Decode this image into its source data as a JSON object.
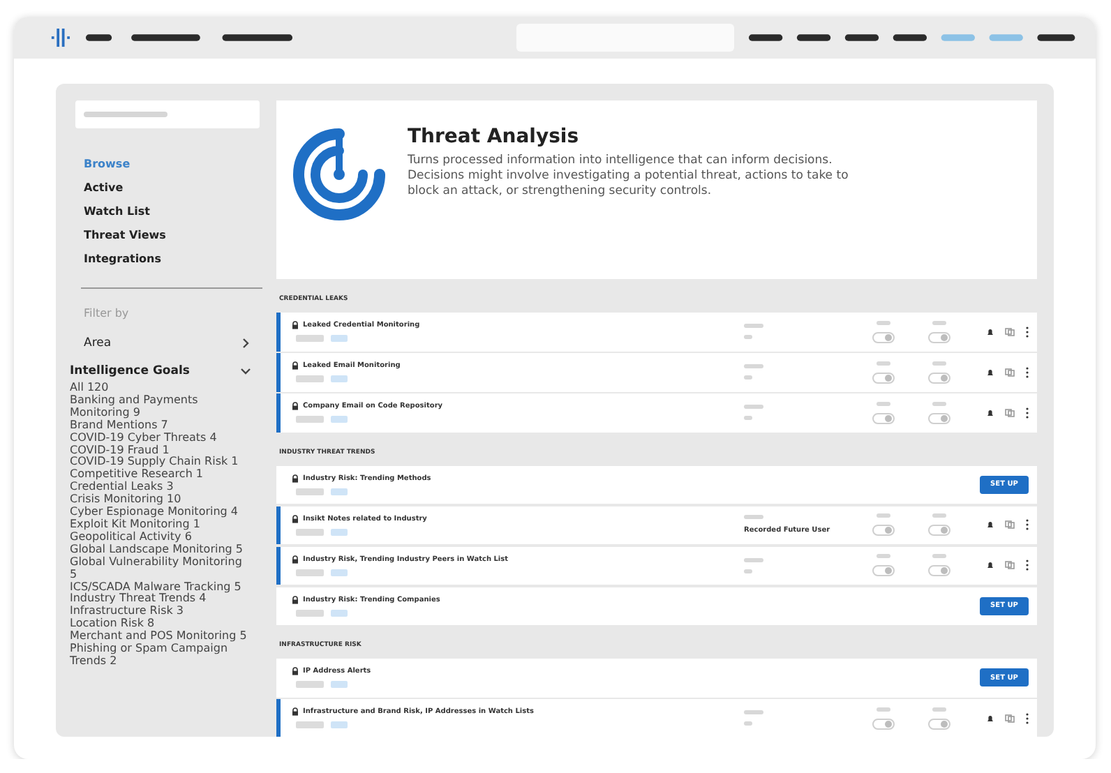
{
  "sidebar": {
    "nav": [
      {
        "label": "Browse",
        "selected": true
      },
      {
        "label": "Active",
        "selected": false
      },
      {
        "label": "Watch List",
        "selected": false
      },
      {
        "label": "Threat Views",
        "selected": false
      },
      {
        "label": "Integrations",
        "selected": false
      }
    ],
    "filter_label": "Filter by",
    "filters": [
      {
        "label": "Area",
        "expanded": false
      },
      {
        "label": "Intelligence Goals",
        "expanded": true,
        "items": [
          "All 120",
          "Banking and Payments Monitoring 9",
          "Brand Mentions 7",
          "COVID-19 Cyber Threats 4",
          "COVID-19 Fraud 1",
          "COVID-19 Supply Chain Risk 1",
          "Competitive Research 1",
          "Credential Leaks 3",
          "Crisis Monitoring 10",
          "Cyber Espionage Monitoring 4",
          "Exploit Kit Monitoring 1",
          "Geopolitical Activity 6",
          "Global Landscape Monitoring 5",
          "Global Vulnerability Monitoring 5",
          "ICS/SCADA Malware Tracking 5",
          "Industry Threat Trends 4",
          "Infrastructure Risk 3",
          "Location Risk 8",
          "Merchant and POS Monitoring 5",
          "Phishing or Spam Campaign Trends 2"
        ]
      }
    ]
  },
  "header": {
    "title": "Threat Analysis",
    "description": "Turns processed information into intelligence that can inform decisions. Decisions might involve investigating a potential threat, actions to take to block an attack, or strengthening security controls."
  },
  "sections": [
    {
      "title": "CREDENTIAL LEAKS",
      "rows": [
        {
          "kind": "active",
          "title": "Leaked Credential Monitoring"
        },
        {
          "kind": "active",
          "title": "Leaked Email Monitoring"
        },
        {
          "kind": "active",
          "title": "Company Email on Code Repository"
        }
      ]
    },
    {
      "title": "INDUSTRY THREAT TRENDS",
      "rows": [
        {
          "kind": "setup",
          "title": "Industry Risk: Trending Methods",
          "button": "SET UP"
        },
        {
          "kind": "active",
          "title": "Insikt Notes related to Industry",
          "category": "Recorded Future User"
        },
        {
          "kind": "active",
          "title": "Industry Risk, Trending Industry Peers in Watch List"
        },
        {
          "kind": "setup",
          "title": "Industry Risk: Trending Companies",
          "button": "SET UP"
        }
      ]
    },
    {
      "title": "INFRASTRUCTURE RISK",
      "rows": [
        {
          "kind": "setup",
          "title": "IP Address Alerts",
          "button": "SET UP"
        },
        {
          "kind": "active",
          "title": "Infrastructure and Brand Risk, IP Addresses in Watch Lists"
        }
      ]
    }
  ]
}
